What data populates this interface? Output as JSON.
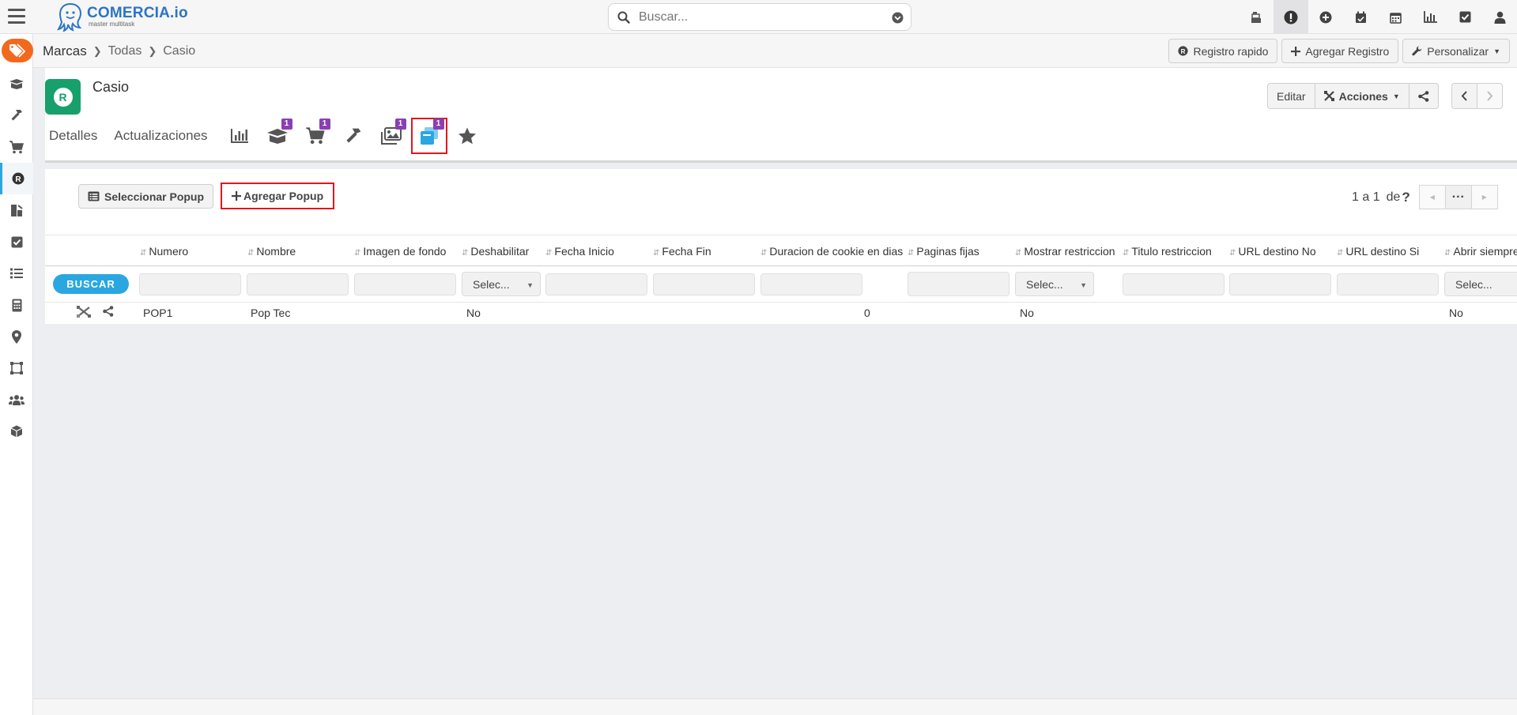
{
  "app": {
    "logo_text": "COMERCIA.io",
    "logo_sub": "master multitask"
  },
  "search": {
    "placeholder": "Buscar..."
  },
  "breadcrumb": {
    "items": [
      "Marcas",
      "Todas",
      "Casio"
    ]
  },
  "crumb_actions": {
    "quick_register": "Registro rapido",
    "add_record": "Agregar Registro",
    "customize": "Personalizar"
  },
  "record": {
    "avatar_letter": "R",
    "title": "Casio",
    "edit": "Editar",
    "actions": "Acciones"
  },
  "tabs": {
    "details": "Detalles",
    "updates": "Actualizaciones",
    "icon_tabs": [
      {
        "icon": "chart-bar-icon",
        "badge": ""
      },
      {
        "icon": "box-open-icon",
        "badge": "1"
      },
      {
        "icon": "shopping-cart-icon",
        "badge": "1"
      },
      {
        "icon": "hammer-icon",
        "badge": ""
      },
      {
        "icon": "images-icon",
        "badge": "1"
      },
      {
        "icon": "popup-windows-icon",
        "badge": "1",
        "active": true
      },
      {
        "icon": "star-icon",
        "badge": ""
      }
    ]
  },
  "panel": {
    "select_popup": "Seleccionar Popup",
    "add_popup": "Agregar Popup",
    "pager_text": "1 a 1",
    "pager_of": "de",
    "pager_unknown": "?"
  },
  "table": {
    "columns": [
      "Numero",
      "Nombre",
      "Imagen de fondo",
      "Deshabilitar",
      "Fecha Inicio",
      "Fecha Fin",
      "Duracion de cookie en dias",
      "Paginas fijas",
      "Mostrar restriccion",
      "Titulo restriccion",
      "URL destino No",
      "URL destino Si",
      "Abrir siempre"
    ],
    "search_button": "BUSCAR",
    "select_placeholder": "Selec...",
    "rows": [
      {
        "numero": "POP1",
        "nombre": "Pop Tec",
        "deshabilitar": "No",
        "duracion": "0",
        "mostrar_restriccion": "No",
        "abrir_siempre": "No"
      }
    ]
  },
  "colors": {
    "accent": "#2aa7e0",
    "brand_orange": "#f2691e",
    "avatar_green": "#17a06b",
    "badge_purple": "#8a3fb4",
    "highlight_red": "#e0161e"
  }
}
